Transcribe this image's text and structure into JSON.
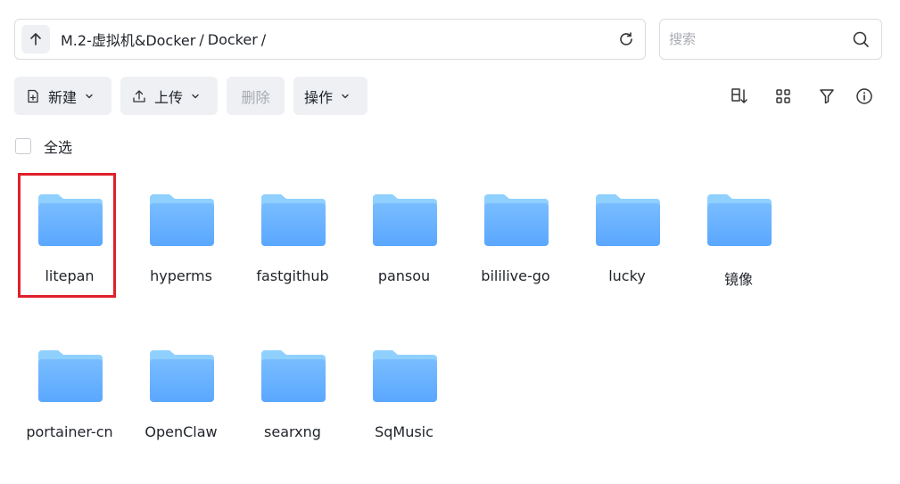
{
  "path": {
    "segments": [
      "M.2-虚拟机&Docker",
      "Docker"
    ],
    "separator": "/"
  },
  "search": {
    "placeholder": "搜索"
  },
  "toolbar": {
    "new_label": "新建",
    "upload_label": "上传",
    "delete_label": "删除",
    "actions_label": "操作"
  },
  "select_all_label": "全选",
  "folders": [
    {
      "name": "litepan",
      "selected": true
    },
    {
      "name": "hyperms"
    },
    {
      "name": "fastgithub"
    },
    {
      "name": "pansou"
    },
    {
      "name": "bililive-go"
    },
    {
      "name": "lucky"
    },
    {
      "name": "镜像"
    },
    {
      "name": "portainer-cn"
    },
    {
      "name": "OpenClaw"
    },
    {
      "name": "searxng"
    },
    {
      "name": "SqMusic"
    }
  ],
  "colors": {
    "folder_front": "#5aa7ff",
    "folder_back": "#8fd0ff",
    "selection_border": "#e0202b"
  }
}
